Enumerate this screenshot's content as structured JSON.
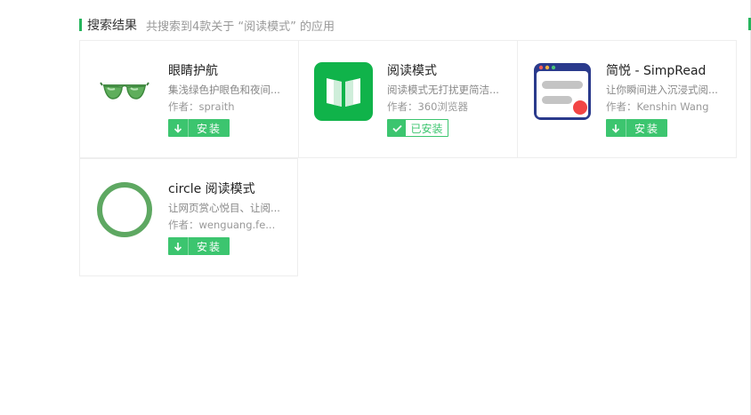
{
  "header": {
    "title": "搜索结果",
    "subtitle": "共搜索到4款关于 “阅读模式” 的应用"
  },
  "colors": {
    "accent": "#26b55d",
    "install_button": "#3cc56f"
  },
  "apps": [
    {
      "name": "眼睛护航",
      "description": "集浅绿色护眼色和夜间...",
      "author_label": "作者：",
      "author": "spraith",
      "button": "安装",
      "installed": false,
      "icon": "green-sunglasses-icon"
    },
    {
      "name": "阅读模式",
      "description": "阅读模式无打扰更简洁...",
      "author_label": "作者：",
      "author": "360浏览器",
      "button": "已安装",
      "installed": true,
      "icon": "open-book-icon"
    },
    {
      "name": "简悦 - SimpRead",
      "description": "让你瞬间进入沉浸式阅...",
      "author_label": "作者：",
      "author": "Kenshin Wang",
      "button": "安装",
      "installed": false,
      "icon": "browser-window-icon"
    },
    {
      "name": "circle 阅读模式",
      "description": "让网页赏心悦目、让阅...",
      "author_label": "作者：",
      "author": "wenguang.fe...",
      "button": "安装",
      "installed": false,
      "icon": "green-ring-icon"
    }
  ]
}
